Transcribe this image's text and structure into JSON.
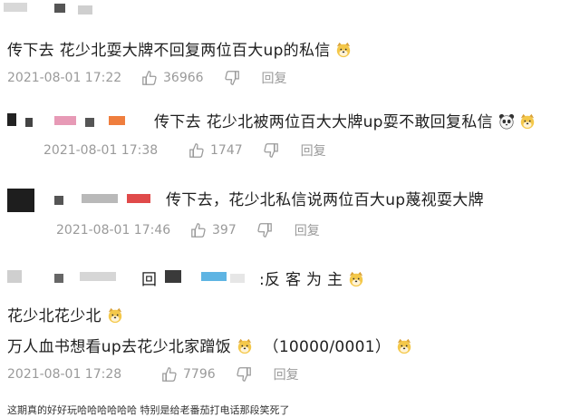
{
  "comments": [
    {
      "text": "传下去 花少北耍大牌不回复两位百大up的私信",
      "timestamp": "2021-08-01 17:22",
      "likes": "36966",
      "reply_label": "回复"
    },
    {
      "text": "传下去 花少北被两位百大大牌up耍不敢回复私信",
      "timestamp": "2021-08-01 17:38",
      "likes": "1747",
      "reply_label": "回复"
    },
    {
      "text": "传下去，花少北私信说两位百大up蔑视耍大牌",
      "timestamp": "2021-08-01 17:46",
      "likes": "397",
      "reply_label": "回复"
    },
    {
      "quote_prefix": "回",
      "quote_suffix": ":反 客 为 主",
      "line1": "花少北花少北",
      "line2_a": "万人血书想看up去花少北家蹭饭",
      "line2_b": "（10000/0001）",
      "timestamp": "2021-08-01 17:28",
      "likes": "7796",
      "reply_label": "回复"
    }
  ],
  "cutoff_text": "这期真的好好玩哈哈哈哈哈哈 特别是给老番茄打电话那段笑死了",
  "colors": {
    "meta_gray": "#9a9a9a",
    "emoji_yellow": "#f4c84a"
  }
}
